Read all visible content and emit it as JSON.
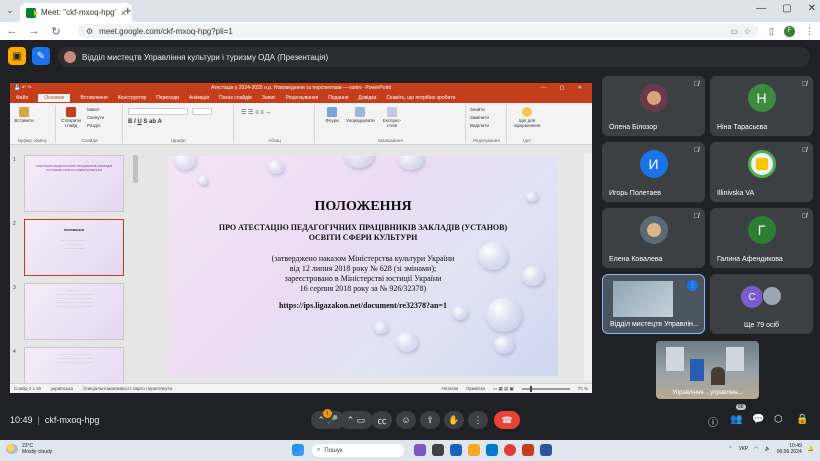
{
  "browser": {
    "tab_title": "Meet: \"ckf-mxoq-hpg\"",
    "tab_close": "×",
    "new_tab": "+",
    "url": "meet.google.com/ckf-mxoq-hpg?pli=1",
    "profile_initial": "F",
    "window_controls": [
      "—",
      "▢",
      "✕"
    ]
  },
  "meet": {
    "presenting_banner": "Відділ мистецтв Управління культури і туризму ОДА (Презентація)",
    "meeting_time": "10:49",
    "meeting_code": "ckf-mxoq-hpg",
    "participant_count": "88",
    "hand_badge": "1",
    "participants": [
      {
        "name": "Олена Білозор",
        "initial": "",
        "color": "#6b3a4a"
      },
      {
        "name": "Ніна Тарасьєва",
        "initial": "Н",
        "color": "#3c8b3e"
      },
      {
        "name": "Игорь Полетаев",
        "initial": "И",
        "color": "#1a73e8"
      },
      {
        "name": "Illinivska VA",
        "initial": "",
        "color": "#f2f2f2"
      },
      {
        "name": "Елена Ковалева",
        "initial": "",
        "color": "#5c6a78"
      },
      {
        "name": "Галина Афендикова",
        "initial": "Г",
        "color": "#2e7d32"
      },
      {
        "name": "Відділ мистецтв Управлін...",
        "initial": "",
        "color": "#4a5560"
      },
      {
        "name": "Ще 79 осіб",
        "initial": "С",
        "color": "#7b5ccf"
      }
    ],
    "self_view_name": "Управління ...управлінн..."
  },
  "powerpoint": {
    "title_bar": "Атестація у 2024-2025 н.р. Нововедення та перспективи — копія  -  PowerPoint",
    "ribbon_tabs": [
      "Файл",
      "Основне",
      "Вставлення",
      "Конструктор",
      "Переходи",
      "Анімація",
      "Показ слайдів",
      "Запис",
      "Рецензування",
      "Подання",
      "Довідка",
      "Скажіть, що потрібно зробити"
    ],
    "ribbon_groups": [
      "Буфер обміну",
      "Слайди",
      "Шрифт",
      "Абзац",
      "Малювання",
      "Редагування",
      "Ідеї"
    ],
    "ribbon_buttons": {
      "paste": "Вставити",
      "new_slide": "Створити слайд",
      "layout": "Макет",
      "reset": "Скинути",
      "section": "Розділ",
      "shapes": "Фігури",
      "arrange": "Упорядкувати",
      "quick_styles": "Експрес-стилі",
      "find": "Знайти",
      "replace": "Замінити",
      "select": "Виділити",
      "design_ideas": "Ідеї для оформлення"
    },
    "thumb_numbers": [
      "1",
      "2",
      "3",
      "4"
    ],
    "thumb1_title": "АТЕСТАЦІЯ ПЕДАГОГІЧНИХ ПРАЦІВНИКІВ ЗАКЛАДІВ (УСТАНОВ) ОСВІТИ СФЕРИ КУЛЬТУРИ",
    "thumb2_title": "ПОЛОЖЕННЯ",
    "slide": {
      "heading": "ПОЛОЖЕННЯ",
      "subheading": "ПРО АТЕСТАЦІЮ ПЕДАГОГІЧНИХ ПРАЦІВНИКІВ ЗАКЛАДІВ (УСТАНОВ) ОСВІТИ СФЕРИ КУЛЬТУРИ",
      "body_line1": "(затверджено наказом Міністерства культури України",
      "body_line2": "від 12 липня 2018 року № 628 (зі змінами);",
      "body_line3": "зареєстровано в Міністерстві юстиції України",
      "body_line4": "16 серпня 2018 року за № 926/32378)",
      "link": "https://ips.ligazakon.net/document/re32378?an=1"
    },
    "status": {
      "slide_of": "Слайд 2 з 19",
      "language": "українська",
      "accessibility": "Спеціальні можливості: варто переглянути",
      "notes": "Нотатки",
      "comments": "Примітки",
      "zoom": "72 %"
    }
  },
  "taskbar": {
    "temperature": "23°C",
    "weather": "Mostly cloudy",
    "search_placeholder": "Пошук",
    "language": "УКР",
    "time": "10:49",
    "date": "06.06.2024"
  },
  "colors": {
    "meet_bg": "#202124",
    "ppt_accent": "#c43e1c",
    "end_call": "#ea4335"
  }
}
